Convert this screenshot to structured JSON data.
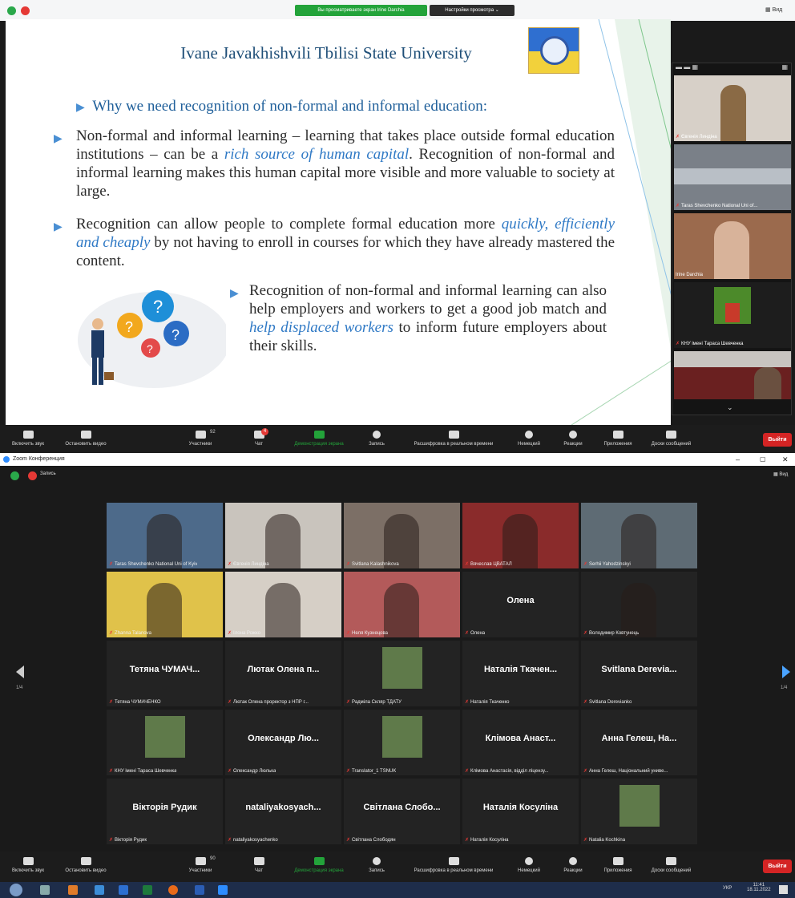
{
  "top": {
    "share_banner": "Вы просматриваете экран Irine Darchia",
    "view_options": "Настройки просмотра ⌄",
    "view_label": "Вид",
    "slide": {
      "title": "Ivane Javakhishvili Tbilisi State University",
      "heading": "Why we need recognition of non-formal and informal education:",
      "bullet1": {
        "pre": "Non-formal and informal learning – learning that takes place outside formal education institutions – can be a ",
        "em": "rich source of human capital",
        "post": ". Recognition of non-formal and informal learning makes this human capital more visible and more valuable to society at large."
      },
      "bullet2": {
        "pre": "Recognition can allow people to complete formal education more ",
        "em": "quickly, efficiently and cheaply",
        "post": " by not having to enroll in courses for which they have already mastered the content."
      },
      "bullet3": {
        "pre": "Recognition of non-formal and informal learning can also help employers and workers to get a good job match and ",
        "em": "help displaced workers",
        "post": " to inform future employers about their skills."
      }
    },
    "panel": [
      {
        "name": "Євгенія Линдіна"
      },
      {
        "name": "Taras Shevchenko National Uni of..."
      },
      {
        "name": "Irine Darchia"
      },
      {
        "name": "КНУ імені Тараса Шевченка"
      },
      {
        "name": ""
      }
    ],
    "toolbar": {
      "mute": "Включить звук",
      "video": "Остановить видео",
      "participants": "Участники",
      "participants_count": "92",
      "chat": "Чат",
      "chat_badge": "4",
      "share": "Демонстрация экрана",
      "record": "Запись",
      "transcription": "Расшифровка в реальном времени",
      "interp": "Немецкий",
      "reactions": "Реакции",
      "apps": "Приложения",
      "boards": "Доски сообщений",
      "leave": "Выйти"
    }
  },
  "bottom": {
    "window_title": "Zoom Конференция",
    "rec_label": "Запись",
    "view_label": "Вид",
    "page_left": "1/4",
    "page_right": "1/4",
    "tiles": [
      {
        "big": "",
        "name": "Taras Shevchenko National Uni of Kyiv",
        "color": "#4d6a8a"
      },
      {
        "big": "",
        "name": "Євгенія Линдіна",
        "color": "#c9c4bd"
      },
      {
        "big": "",
        "name": "Svitlana Kalashnikova",
        "color": "#7c6f66"
      },
      {
        "big": "",
        "name": "Вячеслав ЦВАТАЛ",
        "color": "#8a2b2b"
      },
      {
        "big": "",
        "name": "Serhii Yahodzinskyi",
        "color": "#5e6b74"
      },
      {
        "big": "",
        "name": "Zhanna Talanova",
        "color": "#e0c24a"
      },
      {
        "big": "",
        "name": "Ілона Рожко",
        "color": "#d6cfc6"
      },
      {
        "big": "",
        "name": "Неля Кузнецова",
        "color": "#b35a5a"
      },
      {
        "big": "Олена",
        "name": "Олена",
        "color": "#232323"
      },
      {
        "big": "",
        "name": "Володимир Ковтунець",
        "color": "#232323"
      },
      {
        "big": "Тетяна ЧУМАЧ...",
        "name": "Тетяна ЧУМАЧЕНКО",
        "color": "#232323"
      },
      {
        "big": "Лютак Олена п...",
        "name": "Лютак Олена проректор з НПР г...",
        "color": "#232323"
      },
      {
        "big": "",
        "name": "Радміла Скляр ТДАТУ",
        "color": "#232323"
      },
      {
        "big": "Наталія Ткачен...",
        "name": "Наталія Ткаченко",
        "color": "#232323"
      },
      {
        "big": "Svitlana Derevia...",
        "name": "Svitlana Derevianko",
        "color": "#232323"
      },
      {
        "big": "",
        "name": "КНУ імені Тараса Шевченка",
        "color": "#232323"
      },
      {
        "big": "Олександр Лю...",
        "name": "Олександр Люлька",
        "color": "#232323"
      },
      {
        "big": "",
        "name": "Translator_1 TSNUK",
        "color": "#232323"
      },
      {
        "big": "Клімова Анаст...",
        "name": "Клімова Анастасія, відділ ліцензу...",
        "color": "#232323"
      },
      {
        "big": "Анна Гелеш, На...",
        "name": "Анна Гелеш, Національний униве...",
        "color": "#232323"
      },
      {
        "big": "Вікторія Рудик",
        "name": "Вікторія Рудик",
        "color": "#232323"
      },
      {
        "big": "nataliyakosyach...",
        "name": "nataliyakosyachenko",
        "color": "#232323"
      },
      {
        "big": "Світлана Слобо...",
        "name": "Світлана Слободян",
        "color": "#232323"
      },
      {
        "big": "Наталія Косуліна",
        "name": "Наталія Косуліна",
        "color": "#232323"
      },
      {
        "big": "",
        "name": "Natalia Kochkina",
        "color": "#232323"
      }
    ],
    "toolbar": {
      "mute": "Включить звук",
      "video": "Остановить видео",
      "participants": "Участники",
      "participants_count": "90",
      "chat": "Чат",
      "share": "Демонстрация экрана",
      "record": "Запись",
      "transcription": "Расшифровка в реальном времени",
      "interp": "Немецкий",
      "reactions": "Реакции",
      "apps": "Приложения",
      "boards": "Доски сообщений",
      "leave": "Выйти"
    },
    "taskbar": {
      "lang": "УКР",
      "time": "11:41",
      "date": "18.11.2022"
    }
  }
}
